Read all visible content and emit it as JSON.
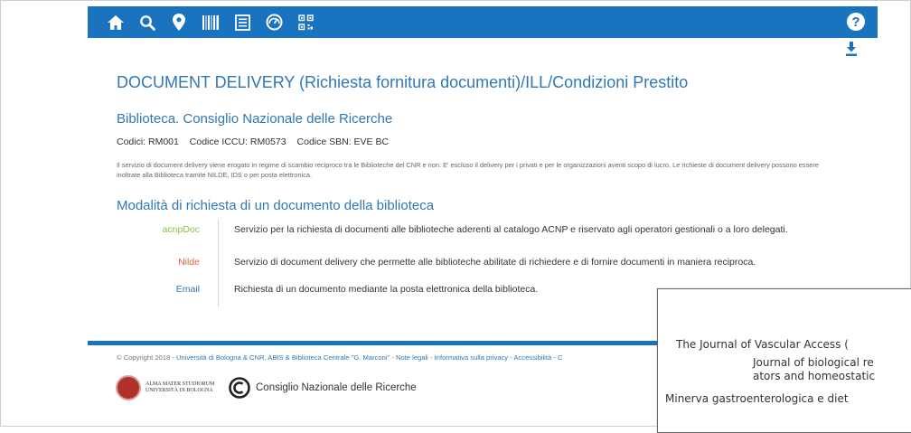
{
  "toolbar": {
    "icons": [
      "home-icon",
      "search-icon",
      "map-pin-icon",
      "barcode-icon",
      "list-icon",
      "dashboard-icon",
      "qr-code-icon"
    ],
    "help_label": "?",
    "accent": "#1a73bf"
  },
  "page": {
    "title": "DOCUMENT DELIVERY (Richiesta fornitura documenti)/ILL/Condizioni Prestito",
    "library_name": "Biblioteca. Consiglio Nazionale delle Ricerche",
    "codes": [
      "Codici: RM001",
      "Codice ICCU: RM0573",
      "Codice SBN: EVE BC"
    ],
    "description": "Il servizio di document delivery viene erogato in regime di scambio reciproco tra le Biblioteche del CNR e non. E' escluso il delivery per i privati e per le organizzazioni aventi scopo di lucro. Le richieste di document delivery possono essere inoltrate alla Biblioteca tramite NILDE, IDS o per posta elettronica.",
    "section_title": "Modalità di richiesta di un documento della biblioteca",
    "methods": [
      {
        "label": "acnpDoc",
        "text": "Servizio per la richiesta di documenti alle biblioteche aderenti al catalogo ACNP e riservato agli operatori gestionali o a loro delegati."
      },
      {
        "label": "Nilde",
        "text": "Servizio di document delivery che permette alle biblioteche abilitate di richiedere e di fornire documenti in maniera reciproca."
      },
      {
        "label": "Email",
        "text": "Richiesta di un documento mediante la posta elettronica della biblioteca."
      }
    ]
  },
  "footer": {
    "copyright_prefix": "© Copyright 2018 - ",
    "links": [
      "Università di Bologna & CNR, ABIS & Biblioteca Centrale \"G. Marconi\"",
      "Note legali",
      "Informativa sulla privacy",
      "Accessibilità",
      "C"
    ],
    "unibo_line1": "ALMA MATER STUDIORUM",
    "unibo_line2": "UNIVERSITÀ DI BOLOGNA",
    "cnr_name": "Consiglio Nazionale delle Ricerche"
  },
  "overlay": {
    "line1": "The Journal of Vascular Access (",
    "line2": "Journal of biological re",
    "line3": "ators and homeostatic",
    "line4": "Minerva gastroenterologica e diet"
  }
}
